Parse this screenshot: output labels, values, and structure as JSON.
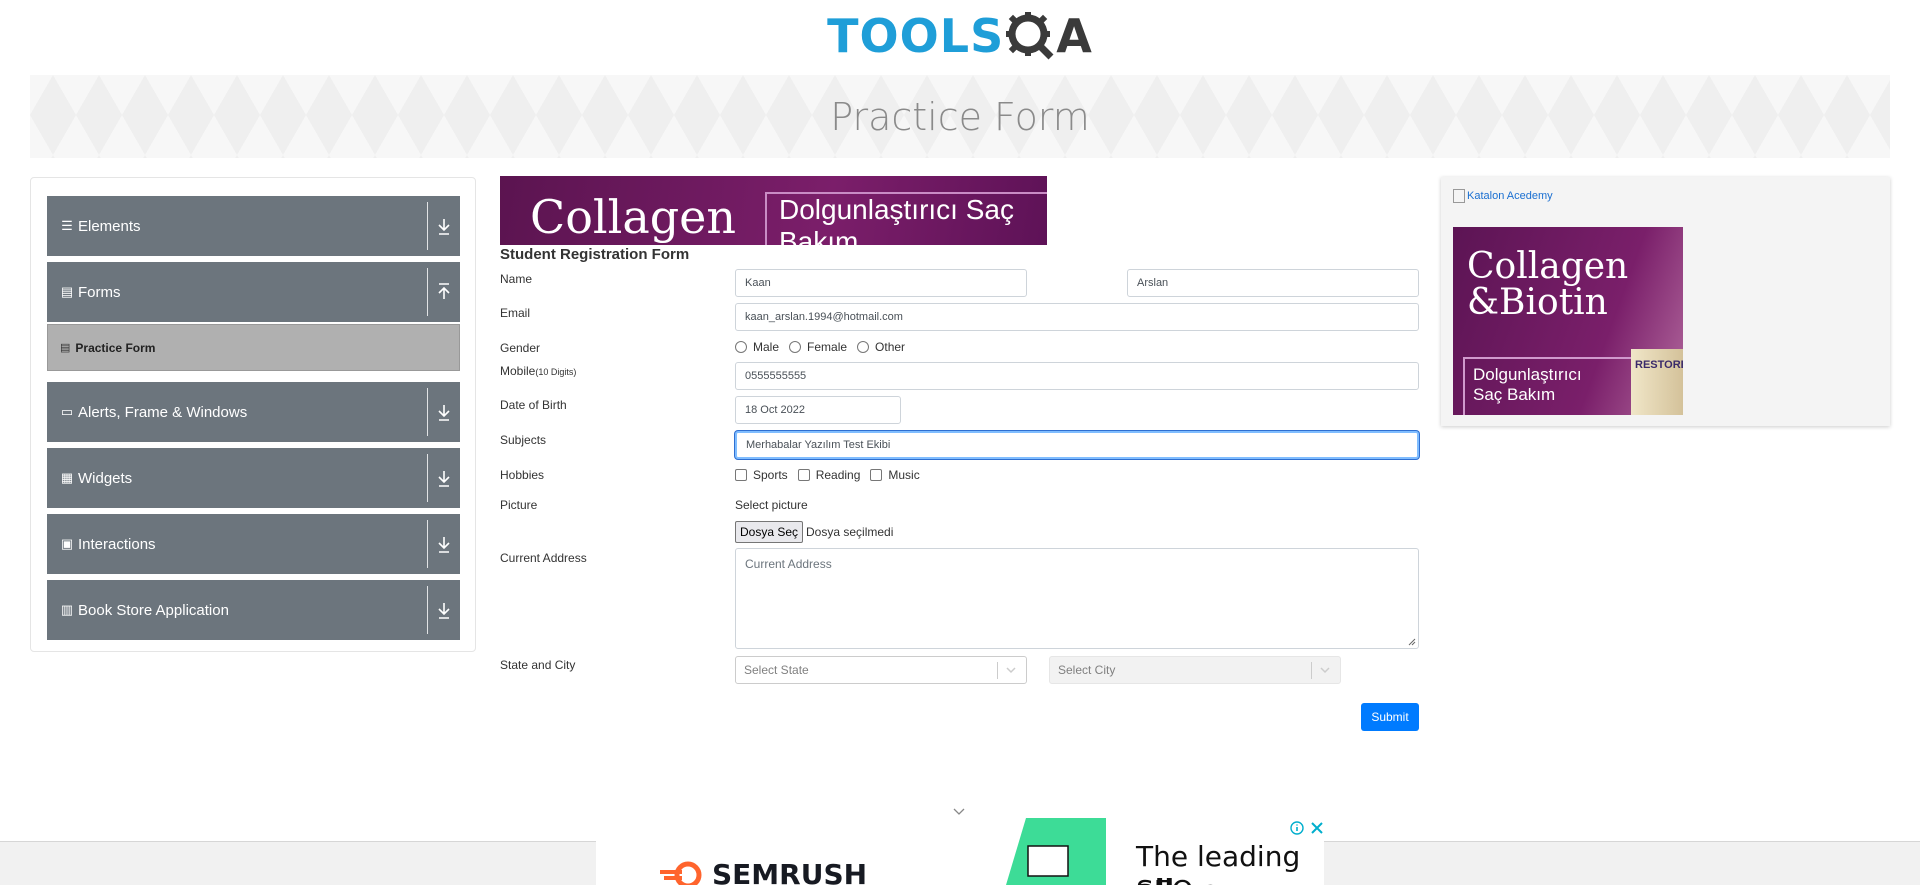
{
  "logo": {
    "part1": "TOOLS",
    "part2": "A"
  },
  "banner": {
    "title": "Practice Form"
  },
  "sidebar": {
    "groups": [
      {
        "label": "Elements",
        "icon": "hamburger-icon"
      },
      {
        "label": "Forms",
        "icon": "document-icon",
        "sub": "Practice Form"
      },
      {
        "label": "Alerts, Frame & Windows",
        "icon": "window-icon"
      },
      {
        "label": "Widgets",
        "icon": "grid-icon"
      },
      {
        "label": "Interactions",
        "icon": "interactions-icon"
      },
      {
        "label": "Book Store Application",
        "icon": "books-icon"
      }
    ]
  },
  "top_ad": {
    "text1": "Collagen",
    "text2": "Dolgunlaştırıcı\nSaç Bakım"
  },
  "form": {
    "title": "Student Registration Form",
    "name_label": "Name",
    "first_name": "Kaan",
    "last_name": "Arslan",
    "email_label": "Email",
    "email": "kaan_arslan.1994@hotmail.com",
    "gender_label": "Gender",
    "gender_options": [
      "Male",
      "Female",
      "Other"
    ],
    "mobile_label": "Mobile",
    "mobile_hint": "(10 Digits)",
    "mobile": "0555555555",
    "dob_label": "Date of Birth",
    "dob": "18 Oct 2022",
    "subjects_label": "Subjects",
    "subjects": "Merhabalar Yazılım Test Ekibi",
    "hobbies_label": "Hobbies",
    "hobbies": [
      "Sports",
      "Reading",
      "Music"
    ],
    "picture_label": "Picture",
    "select_picture": "Select picture",
    "file_button": "Dosya Seç",
    "file_status": "Dosya seçilmedi",
    "address_label": "Current Address",
    "address_placeholder": "Current Address",
    "state_city_label": "State and City",
    "state_placeholder": "Select State",
    "city_placeholder": "Select City",
    "submit": "Submit"
  },
  "right_ad": {
    "katalon_alt": "Katalon Acedemy",
    "headline": "Collagen\n&Biotin",
    "sub": "Dolgunlaştırıcı\nSaç Bakım",
    "brand": "RESTORE"
  },
  "bottom_ad": {
    "brand": "SEMRUSH",
    "tagline_a": "The leading ",
    "tagline_b": "all",
    "tagline_line2": "SEO a"
  },
  "colors": {
    "primary": "#007bff",
    "sidebar": "#6c757d",
    "logo_blue": "#1f9ed8"
  }
}
